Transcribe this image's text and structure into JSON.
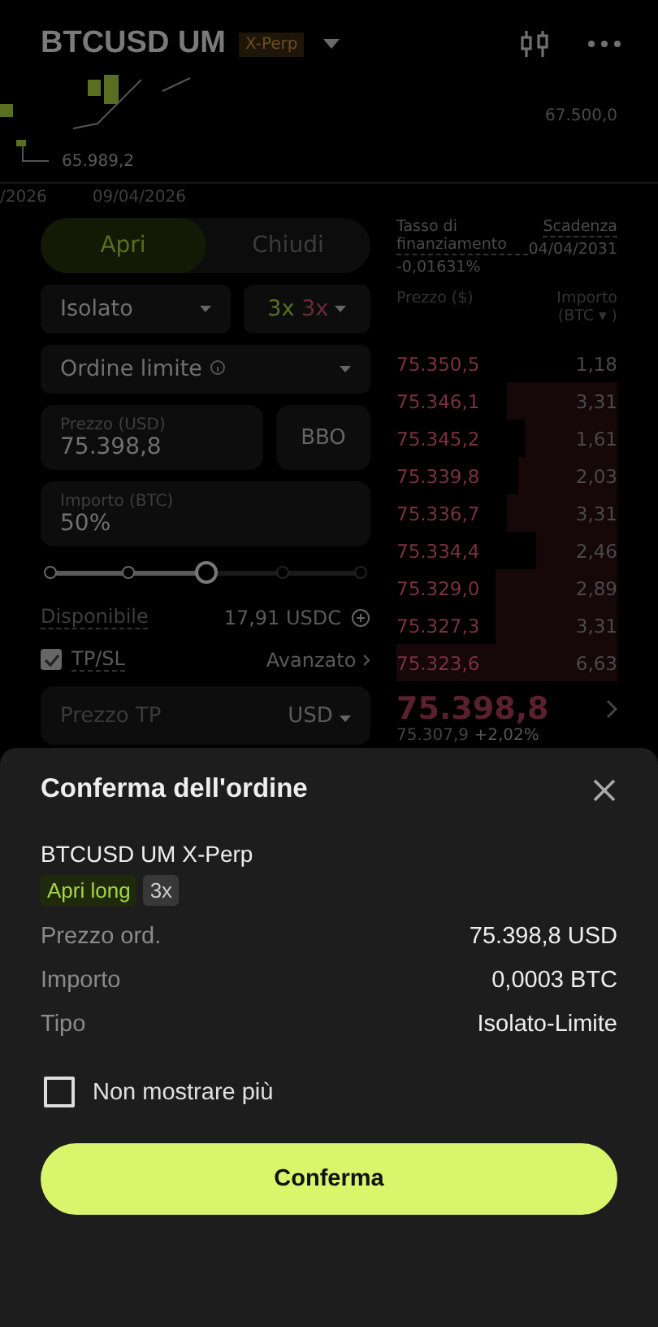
{
  "header": {
    "symbol": "BTCUSD UM",
    "tag": "X-Perp"
  },
  "chart": {
    "high_label": "67.500,0",
    "low_label": "65.989,2",
    "dates": [
      "/2026",
      "09/04/2026"
    ]
  },
  "tabs": [
    {
      "label": "Apri",
      "selected": true
    },
    {
      "label": "Chiudi",
      "selected": false
    }
  ],
  "margin_mode": {
    "value": "Isolato"
  },
  "leverage": {
    "long": "3x",
    "short": "3x"
  },
  "order_type": {
    "value": "Ordine limite"
  },
  "price_field": {
    "label": "Prezzo (USD)",
    "value": "75.398,8"
  },
  "bbo_button": "BBO",
  "amount_field": {
    "label": "Importo (BTC)",
    "value": "50%"
  },
  "amount_slider": {
    "level": 0.5
  },
  "available": {
    "label": "Disponibile",
    "value": "17,91 USDC"
  },
  "tpsl": {
    "label": "TP/SL",
    "checked": true,
    "advanced": "Avanzato"
  },
  "tp_field": {
    "placeholder": "Prezzo TP",
    "unit": "USD"
  },
  "funding": {
    "label": "Tasso di finanziamento",
    "value": "-0,01631%",
    "expiry_label": "Scadenza",
    "expiry": "04/04/2031"
  },
  "orderbook": {
    "price_header": "Prezzo ($)",
    "amount_header": "Importo (BTC ▾ )",
    "rows": [
      {
        "price": "75.350,5",
        "amount": "1,18"
      },
      {
        "price": "75.346,1",
        "amount": "3,31"
      },
      {
        "price": "75.345,2",
        "amount": "1,61"
      },
      {
        "price": "75.339,8",
        "amount": "2,03"
      },
      {
        "price": "75.336,7",
        "amount": "3,31"
      },
      {
        "price": "75.334,4",
        "amount": "2,46"
      },
      {
        "price": "75.329,0",
        "amount": "2,89"
      },
      {
        "price": "75.327,3",
        "amount": "3,31"
      },
      {
        "price": "75.323,6",
        "amount": "6,63"
      }
    ],
    "last_price": "75.398,8",
    "mark_price": "75.307,9",
    "change": "+2,02%"
  },
  "dialog": {
    "title": "Conferma dell'ordine",
    "instrument": "BTCUSD UM X-Perp",
    "side_tag": "Apri long",
    "leverage_tag": "3x",
    "details": [
      {
        "label": "Prezzo ord.",
        "value": "75.398,8 USD"
      },
      {
        "label": "Importo",
        "value": "0,0003 BTC"
      },
      {
        "label": "Tipo",
        "value": "Isolato-Limite"
      }
    ],
    "dont_show_again": {
      "label": "Non mostrare più",
      "checked": false
    },
    "confirm_button": "Conferma"
  }
}
